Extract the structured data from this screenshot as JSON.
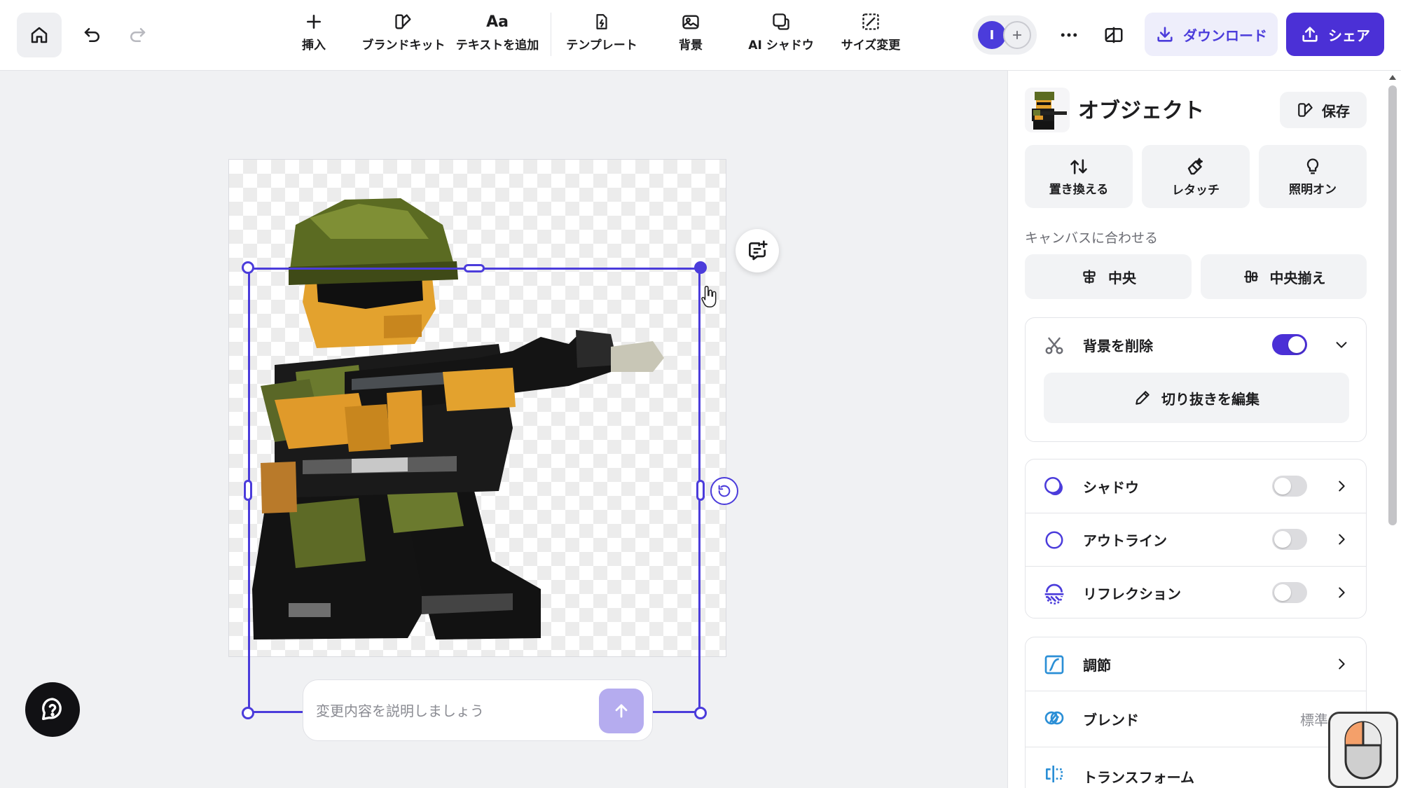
{
  "toolbar": {
    "tools": [
      {
        "label": "挿入",
        "icon": "plus-icon"
      },
      {
        "label": "ブランドキット",
        "icon": "brand-kit-icon"
      },
      {
        "label": "テキストを追加",
        "icon": "text-aa-icon"
      },
      {
        "label": "テンプレート",
        "icon": "template-icon"
      },
      {
        "label": "背景",
        "icon": "background-icon"
      },
      {
        "label": "AI シャドウ",
        "icon": "ai-shadow-icon"
      },
      {
        "label": "サイズ変更",
        "icon": "resize-icon"
      }
    ],
    "avatar_initial": "I",
    "download_label": "ダウンロード",
    "share_label": "シェア"
  },
  "canvas": {
    "prompt_placeholder": "変更内容を説明しましょう"
  },
  "panel": {
    "title": "オブジェクト",
    "save_label": "保存",
    "actions": [
      {
        "label": "置き換える",
        "icon": "replace-icon"
      },
      {
        "label": "レタッチ",
        "icon": "retouch-eraser-icon"
      },
      {
        "label": "照明オン",
        "icon": "lightbulb-icon"
      }
    ],
    "fit_section_label": "キャンバスに合わせる",
    "fit_center_label": "中央",
    "fit_align_label": "中央揃え",
    "remove_bg_label": "背景を削除",
    "remove_bg_enabled": true,
    "edit_cutout_label": "切り抜きを編集",
    "effects": [
      {
        "label": "シャドウ",
        "enabled": false,
        "icon": "shadow-icon"
      },
      {
        "label": "アウトライン",
        "enabled": false,
        "icon": "outline-icon"
      },
      {
        "label": "リフレクション",
        "enabled": false,
        "icon": "reflection-icon"
      }
    ],
    "adjust_label": "調節",
    "blend_label": "ブレンド",
    "blend_value": "標準",
    "transform_label": "トランスフォーム"
  },
  "colors": {
    "accent": "#4b3cdb",
    "share_bg": "#4b30d6",
    "download_bg": "#eeeefb",
    "panel_bg": "#ffffff",
    "canvas_bg": "#f0f1f3"
  }
}
